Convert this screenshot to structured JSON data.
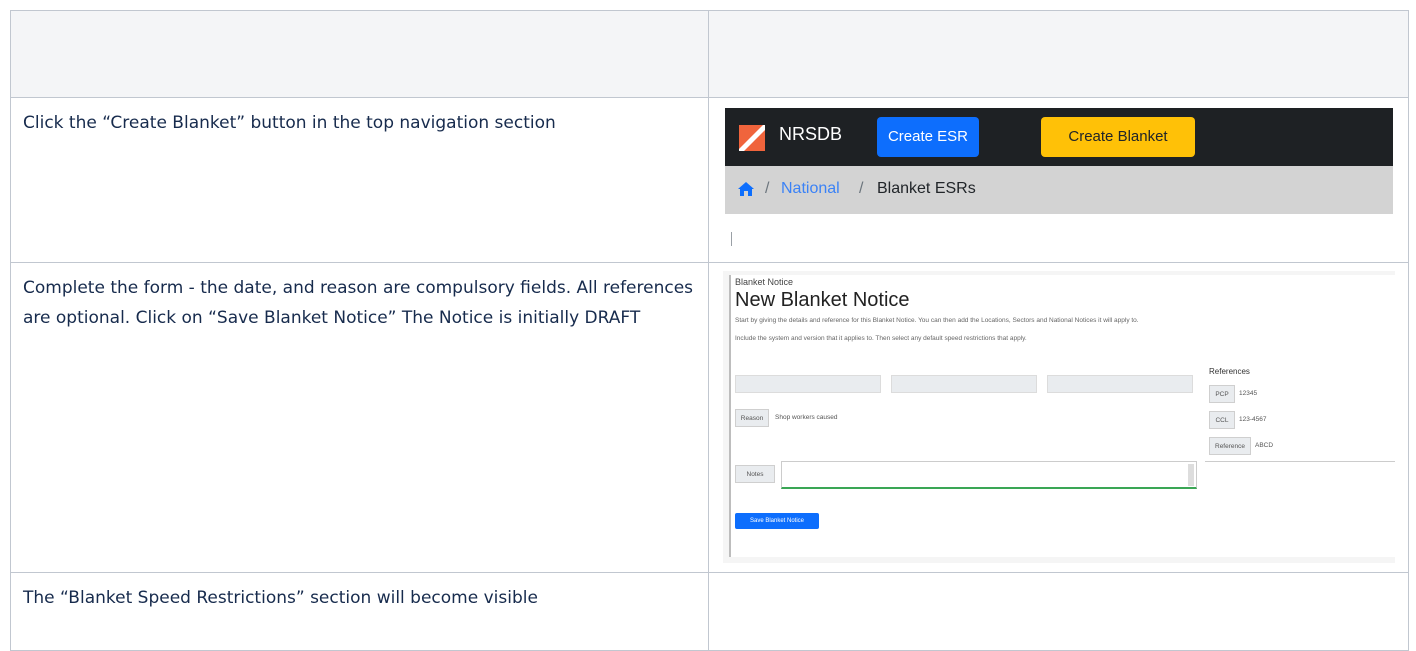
{
  "steps": [
    {
      "text": "Click the “Create Blanket” button in the top navigation section"
    },
    {
      "text": "Complete the form - the date, and reason are compulsory fields. All references are optional. Click on “Save Blanket Notice” The Notice is initially DRAFT"
    },
    {
      "text": "The “Blanket Speed Restrictions” section will become visible"
    }
  ],
  "nav_screenshot": {
    "brand": "NRSDB",
    "create_esr_label": "Create ESR",
    "create_blanket_label": "Create Blanket",
    "breadcrumb_sep": "/",
    "breadcrumb_items": [
      "National",
      "Blanket ESRs"
    ]
  },
  "form_screenshot": {
    "breadcrumb": "Blanket Notice",
    "title": "New Blanket Notice",
    "description_1": "Start by giving the details and reference for this Blanket Notice. You can then add the Locations, Sectors and National Notices it will apply to.",
    "description_2": "Include the system and version that it applies to. Then select any default speed restrictions that apply.",
    "reason_label": "Reason",
    "reason_value": "Shop workers caused",
    "notes_label": "Notes",
    "save_label": "Save Blanket Notice",
    "references_title": "References",
    "references": [
      {
        "label": "PCP",
        "value": "12345"
      },
      {
        "label": "CCL",
        "value": "123-4567"
      },
      {
        "label": "Reference",
        "value": "ABCD"
      }
    ]
  },
  "colors": {
    "navbar": "#1e2124",
    "create_esr": "#0d6efd",
    "create_blanket": "#ffc107",
    "breadcrumb_bg": "#d3d3d3",
    "link": "#3b82f6"
  }
}
